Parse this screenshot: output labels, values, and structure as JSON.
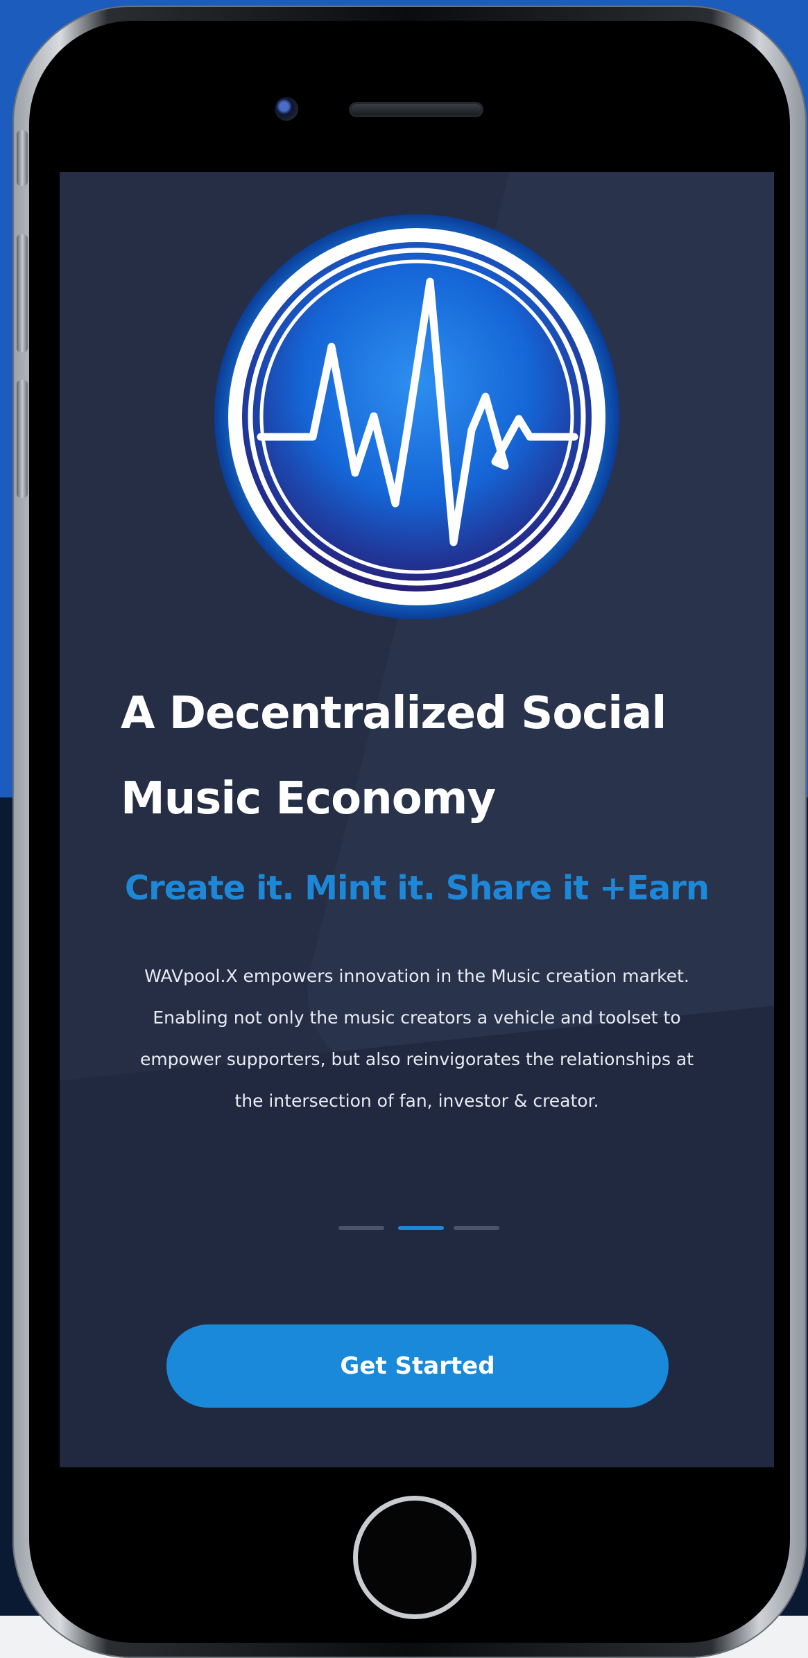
{
  "hero": {
    "title_line1": "A Decentralized Social",
    "title_line2": "Music Economy",
    "tagline": "Create it. Mint it. Share it +Earn",
    "description": "WAVpool.X empowers innovation in the Music creation market. Enabling not only the music creators a vehicle and toolset to empower supporters, but also reinvigorates the relationships at the intersection of fan, investor & creator."
  },
  "carousel": {
    "slide_count": 3,
    "active_slide": 2
  },
  "cta": {
    "label": "Get Started"
  },
  "logo": {
    "icon": "soundwave-logo-icon"
  },
  "colors": {
    "page_blue": "#1b5cbd",
    "page_navy": "#0b1a33",
    "screen_bg": "#252e45",
    "accent": "#1a89d9",
    "title_text": "#ffffff",
    "inactive_indicator": "#4a536a"
  }
}
